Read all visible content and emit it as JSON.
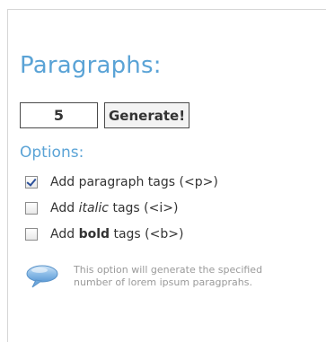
{
  "title": "Paragraphs:",
  "paragraph_count": "5",
  "generate_label": "Generate!",
  "options_heading": "Options:",
  "options": [
    {
      "prefix": "Add ",
      "keyword": "paragraph",
      "suffix": " tags (<p>)",
      "style": "normal",
      "checked": true
    },
    {
      "prefix": "Add ",
      "keyword": "italic",
      "suffix": " tags (<i>)",
      "style": "italic",
      "checked": false
    },
    {
      "prefix": "Add ",
      "keyword": "bold",
      "suffix": " tags (<b>)",
      "style": "bold",
      "checked": false
    }
  ],
  "info_text": "This option will generate the specified number of lorem ipsum paragprahs.",
  "colors": {
    "accent": "#5aa3d6",
    "info_bubble": "#7fb5e3"
  },
  "icons": {
    "info": "speech-bubble-icon"
  }
}
